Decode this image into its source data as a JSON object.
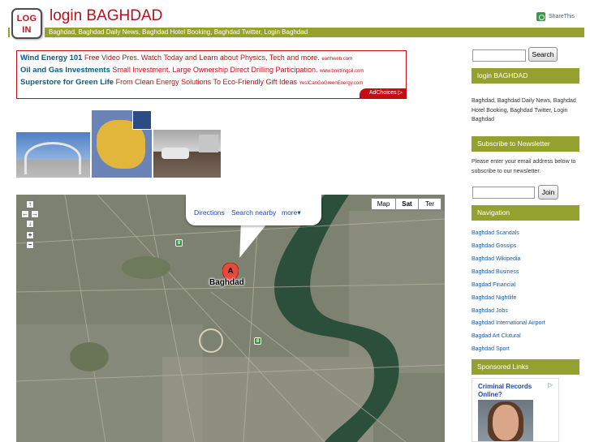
{
  "header": {
    "logo_line1": "LOG",
    "logo_line2": "IN",
    "site_title": "login BAGHDAD",
    "share_label": "ShareThis",
    "tagline": "Baghdad, Baghdad Daily News, Baghdad Hotel Booking, Baghdad Twitter, Login Baghdad"
  },
  "ads": {
    "items": [
      {
        "title": "Wind Energy 101",
        "text": "Free Video Pres. Watch Today and Learn about Physics, Tech and more.",
        "url": "earthweb.com"
      },
      {
        "title": "Oil and Gas Investments",
        "text": "Small Investment. Large Ownership Direct Drilling Participation.",
        "url": "www.breitlingoil.com"
      },
      {
        "title": "Superstore for Green Life",
        "text": "From Clean Energy Solutions To Eco-Friendly Gift Ideas",
        "url": "YesICanGoGreenEnergy.com"
      }
    ],
    "adchoices_label": "AdChoices ▷"
  },
  "map": {
    "directions_link": "Directions",
    "search_nearby_link": "Search nearby",
    "more_link": "more▾",
    "marker_letter": "A",
    "place_label": "Baghdad",
    "type_map": "Map",
    "type_sat": "Sat",
    "type_ter": "Ter",
    "zoom_up": "↑",
    "zoom_left": "←",
    "zoom_right": "→",
    "zoom_down": "↓",
    "zoom_in": "+",
    "zoom_out": "−",
    "road_shield_1": "8",
    "road_shield_2": "8"
  },
  "sidebar": {
    "search_button": "Search",
    "about_heading": "login BAGHDAD",
    "about_text": "Baghdad, Baghdad Daily News, Baghdad Hotel Booking, Baghdad Twitter, Login Baghdad",
    "newsletter_heading": "Subscribe to Newsletter",
    "newsletter_text": "Please enter your email address below to subscribe to our newsletter.",
    "join_button": "Join",
    "navigation_heading": "Navigation",
    "nav_items": [
      "Baghdad Scandals",
      "Baghdad Gossips",
      "Baghdad Wikipedia",
      "Baghdad Business",
      "Bagdad Financial",
      "Baghdad Nightlife",
      "Baghdad Jobs",
      "Baghdad International Airport",
      "Bagdad Art Clutural",
      "Baghdad Sport"
    ],
    "sponsored_heading": "Sponsored Links",
    "sponsored_title": "Criminal Records Online?"
  },
  "colors": {
    "accent_green": "#95a12f",
    "title_red": "#b5121b",
    "ad_border_red": "#c40d12",
    "link_blue": "#1a5a96"
  }
}
